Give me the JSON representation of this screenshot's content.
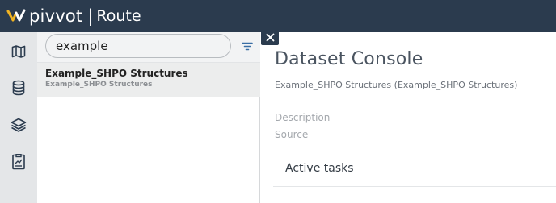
{
  "header": {
    "brand": "pivvot",
    "app": "Route",
    "brand_color": "#2b3b4e",
    "logo_accent": "#f0b323"
  },
  "rail": {
    "items": [
      {
        "icon": "map-icon"
      },
      {
        "icon": "database-icon"
      },
      {
        "icon": "layers-icon"
      },
      {
        "icon": "report-icon"
      }
    ]
  },
  "search": {
    "value": "example",
    "filter_icon": "filter-icon"
  },
  "results": [
    {
      "title": "Example_SHPO Structures",
      "subtitle": "Example_SHPO Structures"
    }
  ],
  "console": {
    "close_icon": "close-icon",
    "title": "Dataset Console",
    "subtitle": "Example_SHPO Structures (Example_SHPO Structures)",
    "description_label": "Description",
    "source_label": "Source",
    "active_tasks_label": "Active tasks"
  }
}
